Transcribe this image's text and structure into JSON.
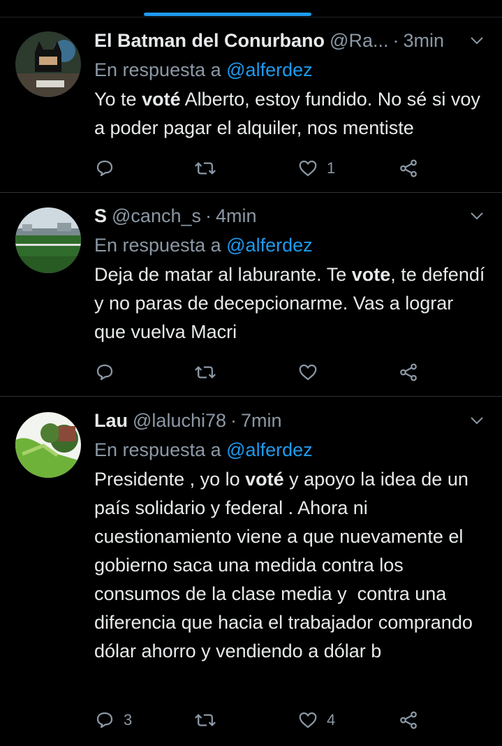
{
  "colors": {
    "background": "#000000",
    "text": "#e7e9ea",
    "muted": "#8b98a5",
    "accent": "#1d9bf0",
    "divider": "#2f3336"
  },
  "icons": {
    "reply": "reply-icon",
    "retweet": "retweet-icon",
    "like": "like-icon",
    "share": "share-icon",
    "more": "chevron-down-icon"
  },
  "tweets": [
    {
      "name": "El Batman del Conurbano",
      "handle": "@Ra...",
      "separator": "·",
      "time": "3min",
      "reply_prefix": "En respuesta a",
      "reply_to": "@alferdez",
      "body_parts": [
        "Yo te ",
        "voté",
        " Alberto, estoy fundido. No sé si voy a poder pagar el alquiler, nos mentiste"
      ],
      "replies": "",
      "retweets": "",
      "likes": "1"
    },
    {
      "name": "S",
      "handle": "@canch_s",
      "separator": "·",
      "time": "4min",
      "reply_prefix": "En respuesta a",
      "reply_to": "@alferdez",
      "body_parts": [
        "Deja de matar al laburante. Te ",
        "vote",
        ", te defendí y no paras de decepcionarme. Vas a lograr que vuelva Macri"
      ],
      "replies": "",
      "retweets": "",
      "likes": ""
    },
    {
      "name": "Lau",
      "handle": "@laluchi78",
      "separator": "·",
      "time": "7min",
      "reply_prefix": "En respuesta a",
      "reply_to": "@alferdez",
      "body_parts": [
        "Presidente , yo lo ",
        "voté",
        " y apoyo la idea de un país solidario y federal . Ahora ni cuestionamiento viene a que nuevamente el gobierno saca una medida contra los consumos de la clase media y  contra una diferencia que hacia el trabajador comprando dólar ahorro y vendiendo a dólar b"
      ],
      "replies": "3",
      "retweets": "",
      "likes": "4"
    }
  ]
}
